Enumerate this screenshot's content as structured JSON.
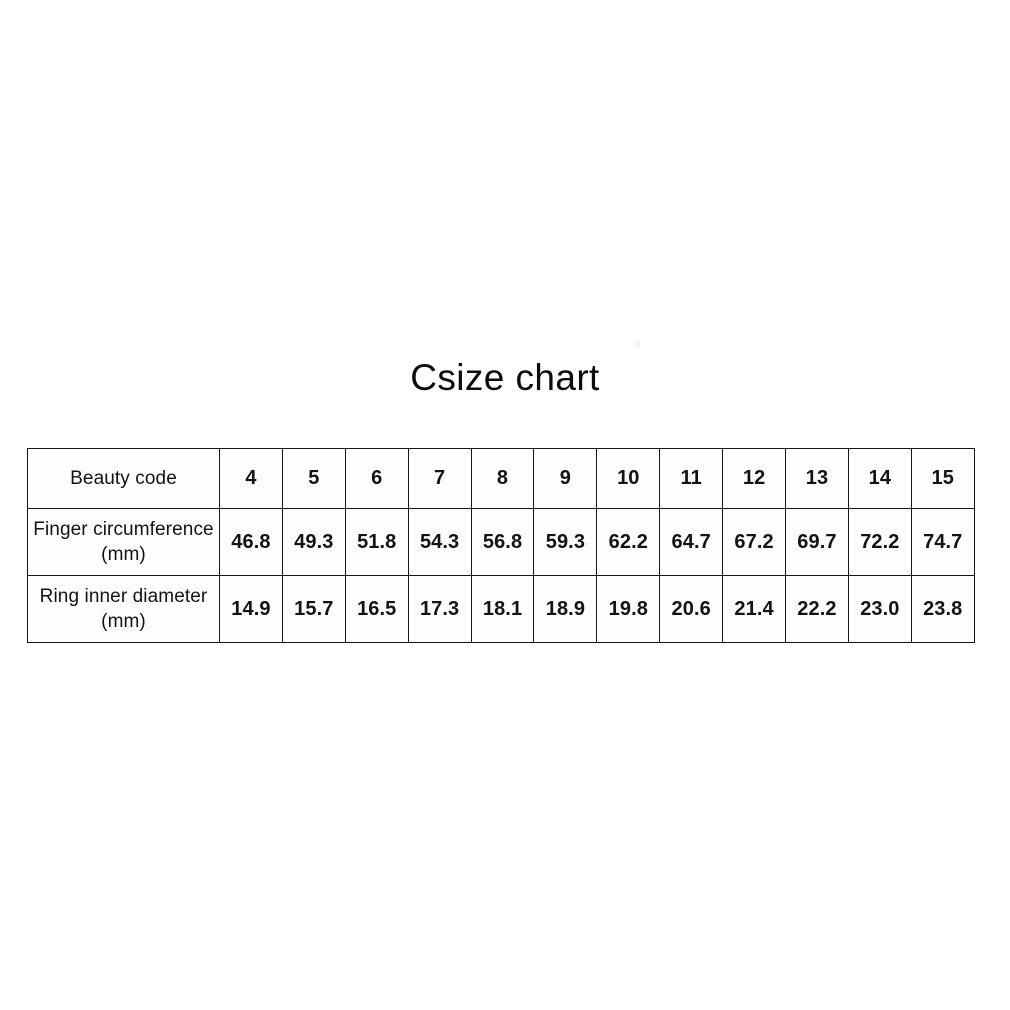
{
  "title": "Csize chart",
  "table": {
    "rows": [
      {
        "label": "Beauty code",
        "label_line1": "Beauty code",
        "label_line2": "",
        "values": [
          "4",
          "5",
          "6",
          "7",
          "8",
          "9",
          "10",
          "11",
          "12",
          "13",
          "14",
          "15"
        ]
      },
      {
        "label": "Finger circumference (mm)",
        "label_line1": "Finger circumference",
        "label_line2": "(mm)",
        "values": [
          "46.8",
          "49.3",
          "51.8",
          "54.3",
          "56.8",
          "59.3",
          "62.2",
          "64.7",
          "67.2",
          "69.7",
          "72.2",
          "74.7"
        ]
      },
      {
        "label": "Ring inner diameter (mm)",
        "label_line1": "Ring inner diameter",
        "label_line2": "(mm)",
        "values": [
          "14.9",
          "15.7",
          "16.5",
          "17.3",
          "18.1",
          "18.9",
          "19.8",
          "20.6",
          "21.4",
          "22.2",
          "23.0",
          "23.8"
        ]
      }
    ]
  },
  "colors": {
    "background": "#ffffff",
    "cell_background": "#fdfdfd",
    "border": "#151515",
    "title_text": "#0c0c0c",
    "label_text": "#2a2a2a",
    "value_text": "#0d0d0d"
  }
}
